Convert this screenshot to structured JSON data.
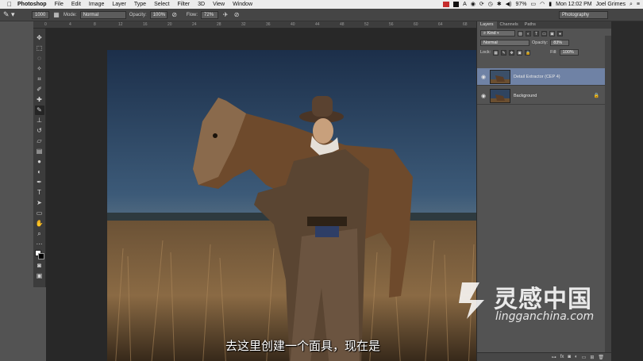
{
  "menubar": {
    "app_name": "Photoshop",
    "items": [
      "File",
      "Edit",
      "Image",
      "Layer",
      "Type",
      "Select",
      "Filter",
      "3D",
      "View",
      "Window"
    ],
    "battery": "97%",
    "clock": "Mon 12:02 PM",
    "user": "Joel Grimes"
  },
  "options": {
    "brush_size": "1000",
    "mode_label": "Mode:",
    "mode_value": "Normal",
    "opacity_label": "Opacity:",
    "opacity_value": "100%",
    "flow_label": "Flow:",
    "flow_value": "72%",
    "workspace": "Photography"
  },
  "ruler": {
    "ticks": [
      "0",
      "4",
      "8",
      "12",
      "16",
      "20",
      "24",
      "28",
      "32",
      "36",
      "40",
      "44",
      "48",
      "52",
      "56",
      "60",
      "64",
      "68"
    ]
  },
  "layers_panel": {
    "tabs": [
      "Layers",
      "Channels",
      "Paths"
    ],
    "filter_kind": "Kind",
    "blend_mode": "Normal",
    "opacity_label": "Opacity:",
    "opacity_value": "83%",
    "lock_label": "Lock:",
    "fill_label": "Fill:",
    "fill_value": "100%",
    "layers": [
      {
        "name": "Detail Extractor (CEP 4)",
        "selected": true
      },
      {
        "name": "Background",
        "selected": false
      }
    ]
  },
  "subtitle": "去这里创建一个面具，现在是",
  "watermark": {
    "title": "灵感中国",
    "url": "lingganchina.com"
  },
  "colors": {
    "selected_layer": "#6f82a5",
    "panel_bg": "#535353",
    "canvas_bg": "#282828"
  }
}
